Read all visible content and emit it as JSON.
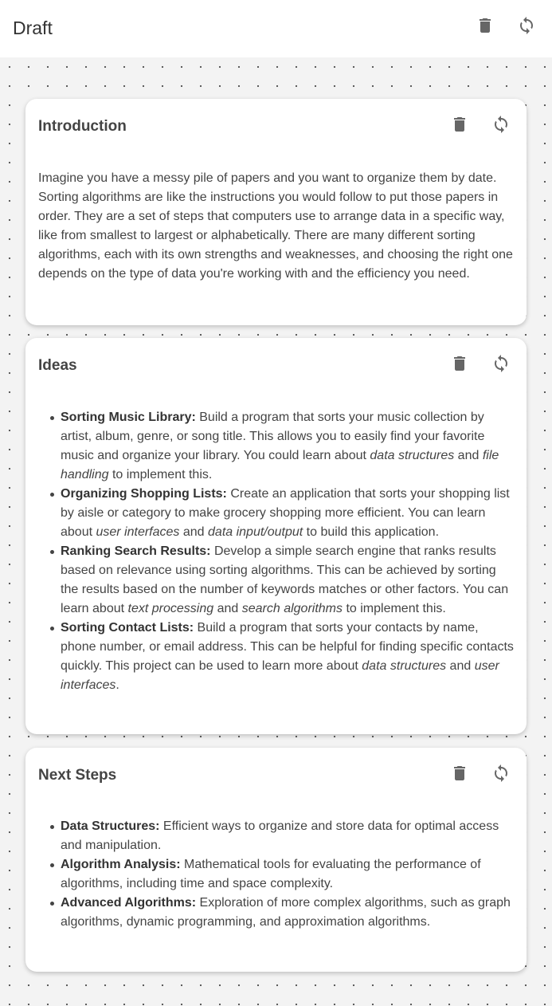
{
  "header": {
    "title": "Draft",
    "icons": [
      "trash-icon",
      "refresh-icon"
    ]
  },
  "cards": [
    {
      "title": "Introduction",
      "paragraph": "Imagine you have a messy pile of papers and you want to organize them by date. Sorting algorithms are like the instructions you would follow to put those papers in order. They are a set of steps that computers use to arrange data in a specific way, like from smallest to largest or alphabetically. There are many different sorting algorithms, each with its own strengths and weaknesses, and choosing the right one depends on the type of data you're working with and the efficiency you need."
    },
    {
      "title": "Ideas",
      "items": [
        {
          "term": "Sorting Music Library:",
          "parts": [
            {
              "text": " Build a program that sorts your music collection by artist, album, genre, or song title. This allows you to easily find your favorite music and organize your library. You could learn about "
            },
            {
              "text": "data structures",
              "em": true
            },
            {
              "text": " and "
            },
            {
              "text": "file handling",
              "em": true
            },
            {
              "text": " to implement this."
            }
          ]
        },
        {
          "term": "Organizing Shopping Lists:",
          "parts": [
            {
              "text": " Create an application that sorts your shopping list by aisle or category to make grocery shopping more efficient. You can learn about "
            },
            {
              "text": "user interfaces",
              "em": true
            },
            {
              "text": " and "
            },
            {
              "text": "data input/output",
              "em": true
            },
            {
              "text": " to build this application."
            }
          ]
        },
        {
          "term": "Ranking Search Results:",
          "parts": [
            {
              "text": " Develop a simple search engine that ranks results based on relevance using sorting algorithms. This can be achieved by sorting the results based on the number of keywords matches or other factors. You can learn about "
            },
            {
              "text": "text processing",
              "em": true
            },
            {
              "text": " and "
            },
            {
              "text": "search algorithms",
              "em": true
            },
            {
              "text": " to implement this."
            }
          ]
        },
        {
          "term": "Sorting Contact Lists:",
          "parts": [
            {
              "text": " Build a program that sorts your contacts by name, phone number, or email address. This can be helpful for finding specific contacts quickly. This project can be used to learn more about "
            },
            {
              "text": "data structures",
              "em": true
            },
            {
              "text": " and "
            },
            {
              "text": "user interfaces",
              "em": true
            },
            {
              "text": "."
            }
          ]
        }
      ]
    },
    {
      "title": "Next Steps",
      "items": [
        {
          "term": "Data Structures:",
          "parts": [
            {
              "text": " Efficient ways to organize and store data for optimal access and manipulation."
            }
          ]
        },
        {
          "term": "Algorithm Analysis:",
          "parts": [
            {
              "text": " Mathematical tools for evaluating the performance of algorithms, including time and space complexity."
            }
          ]
        },
        {
          "term": "Advanced Algorithms:",
          "parts": [
            {
              "text": " Exploration of more complex algorithms, such as graph algorithms, dynamic programming, and approximation algorithms."
            }
          ]
        }
      ]
    }
  ]
}
